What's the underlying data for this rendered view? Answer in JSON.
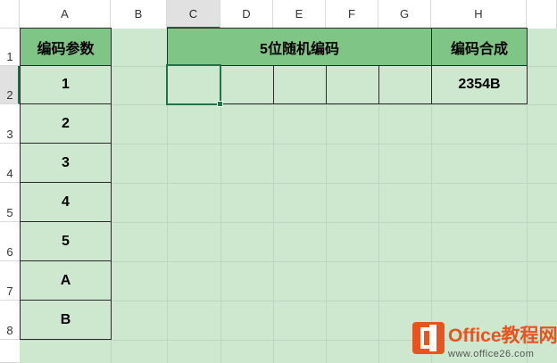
{
  "columns": [
    "A",
    "B",
    "C",
    "D",
    "E",
    "F",
    "G",
    "H"
  ],
  "rows": [
    "1",
    "2",
    "3",
    "4",
    "5",
    "6",
    "7",
    "8"
  ],
  "selected_column": "C",
  "selected_row": "2",
  "table": {
    "param_header": "编码参数",
    "params": [
      "1",
      "2",
      "3",
      "4",
      "5",
      "A",
      "B"
    ],
    "random_header": "5位随机编码",
    "compose_header": "编码合成",
    "compose_value": "2354B"
  },
  "watermark": {
    "title": "Office教程网",
    "url": "www.office26.com",
    "icon": "office-logo-icon",
    "color": "#e8531f"
  }
}
